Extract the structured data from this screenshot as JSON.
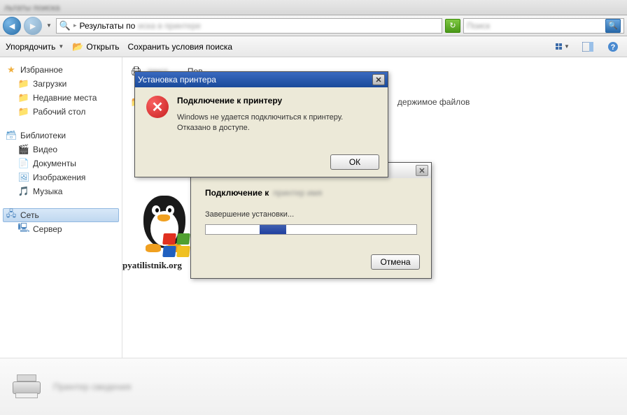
{
  "titlebar": {
    "text": "льтаты поиска"
  },
  "nav": {
    "breadcrumb_label": "Результаты по",
    "search_placeholder": ""
  },
  "toolbar": {
    "organize": "Упорядочить",
    "open": "Открыть",
    "save_search": "Сохранить условия поиска"
  },
  "sidebar": {
    "favorites": {
      "label": "Избранное",
      "items": [
        {
          "label": "Загрузки"
        },
        {
          "label": "Недавние места"
        },
        {
          "label": "Рабочий стол"
        }
      ]
    },
    "libraries": {
      "label": "Библиотеки",
      "items": [
        {
          "label": "Видео"
        },
        {
          "label": "Документы"
        },
        {
          "label": "Изображения"
        },
        {
          "label": "Музыка"
        }
      ]
    },
    "network": {
      "label": "Сеть"
    }
  },
  "content": {
    "row1_label": "Пов",
    "row2_suffix": "держимое файлов"
  },
  "logo_text": "pyatilistnik.org",
  "error_dialog": {
    "title": "Установка принтера",
    "heading": "Подключение к принтеру",
    "line1": "Windows не удается подключиться к принтеру.",
    "line2": "Отказано в доступе.",
    "ok": "ОК"
  },
  "progress_dialog": {
    "connecting_label": "Подключение к",
    "status": "Завершение установки...",
    "cancel": "Отмена"
  }
}
